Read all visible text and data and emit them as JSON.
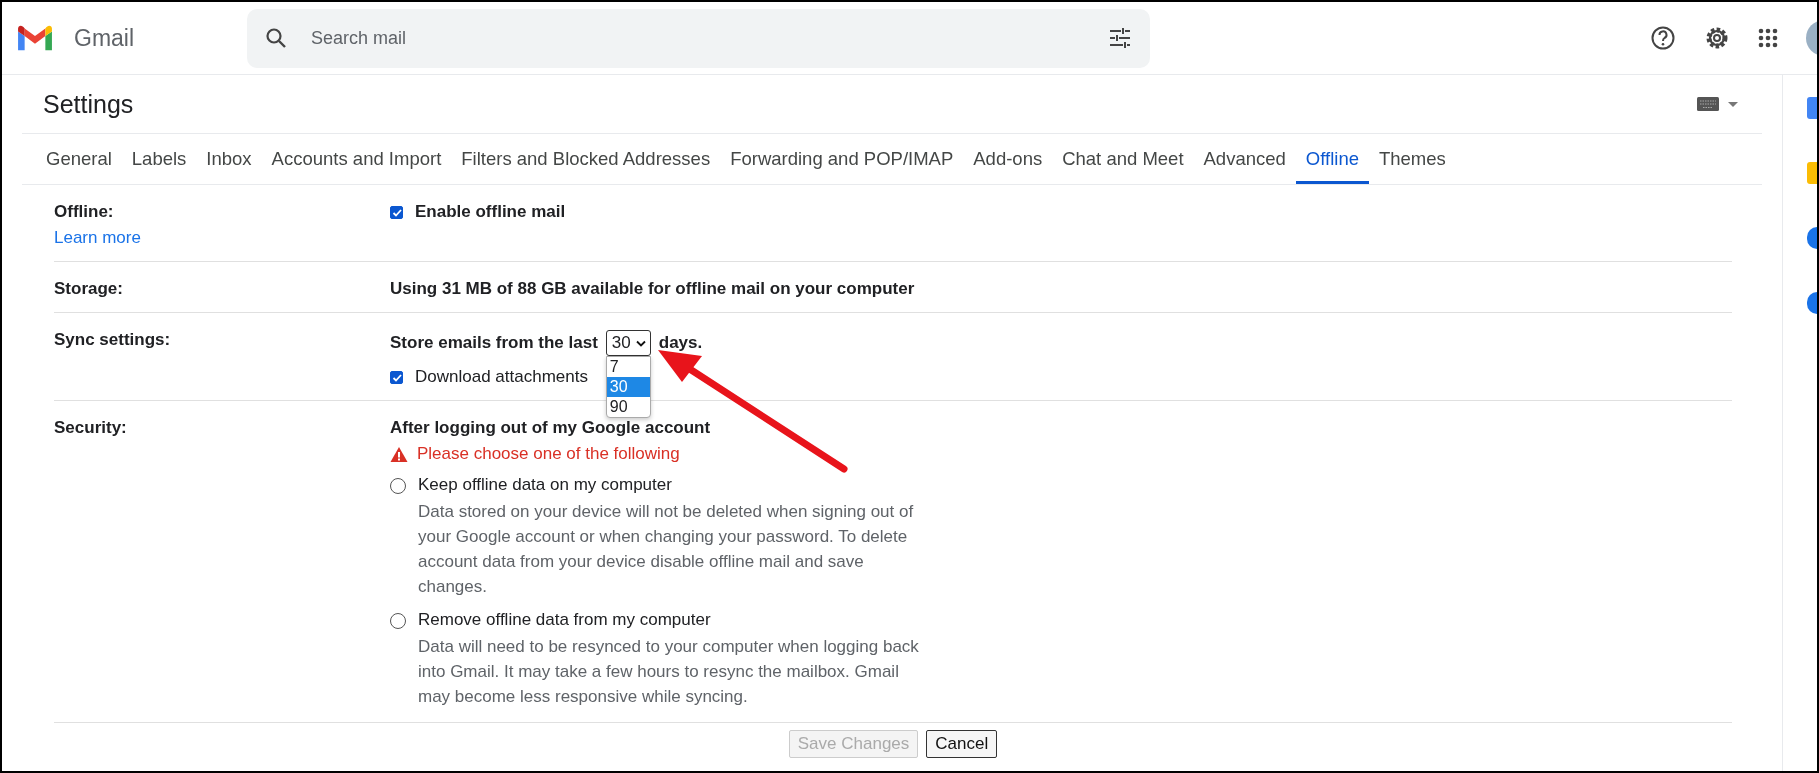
{
  "header": {
    "logo_text": "Gmail",
    "search": {
      "placeholder": "Search mail"
    }
  },
  "page_title": "Settings",
  "tabs": [
    {
      "label": "General",
      "selected": false
    },
    {
      "label": "Labels",
      "selected": false
    },
    {
      "label": "Inbox",
      "selected": false
    },
    {
      "label": "Accounts and Import",
      "selected": false
    },
    {
      "label": "Filters and Blocked Addresses",
      "selected": false
    },
    {
      "label": "Forwarding and POP/IMAP",
      "selected": false
    },
    {
      "label": "Add-ons",
      "selected": false
    },
    {
      "label": "Chat and Meet",
      "selected": false
    },
    {
      "label": "Advanced",
      "selected": false
    },
    {
      "label": "Offline",
      "selected": true
    },
    {
      "label": "Themes",
      "selected": false
    }
  ],
  "sections": [
    {
      "kind": "checkbox",
      "label": "Offline:",
      "link": "Learn more",
      "option": {
        "label": "Enable offline mail",
        "checked": true
      }
    },
    {
      "kind": "text",
      "label": "Storage:",
      "text": "Using 31 MB of 88 GB available for offline mail on your computer"
    },
    {
      "kind": "sync",
      "label": "Sync settings:",
      "before": "Store emails from the last",
      "select": {
        "value": "30",
        "expanded": true,
        "options": [
          {
            "label": "7",
            "selected": false
          },
          {
            "label": "30",
            "selected": true
          },
          {
            "label": "90",
            "selected": false
          }
        ]
      },
      "after": "days.",
      "option": {
        "label": "Download attachments",
        "checked": true
      }
    },
    {
      "kind": "radios",
      "label": "Security:",
      "heading": "After logging out of my Google account",
      "warning": "Please choose one of the following",
      "choices": [
        {
          "label": "Keep offline data on my computer",
          "description": "Data stored on your device will not be deleted when signing out of your Google account or when changing your password. To delete account data from your device disable offline mail and save changes.",
          "selected": false
        },
        {
          "label": "Remove offline data from my computer",
          "description": "Data will need to be resynced to your computer when logging back into Gmail. It may take a few hours to resync the mailbox. Gmail may become less responsive while syncing.",
          "selected": false
        }
      ]
    }
  ],
  "buttons": [
    {
      "label": "Save Changes",
      "disabled": true
    },
    {
      "label": "Cancel",
      "disabled": false
    }
  ]
}
